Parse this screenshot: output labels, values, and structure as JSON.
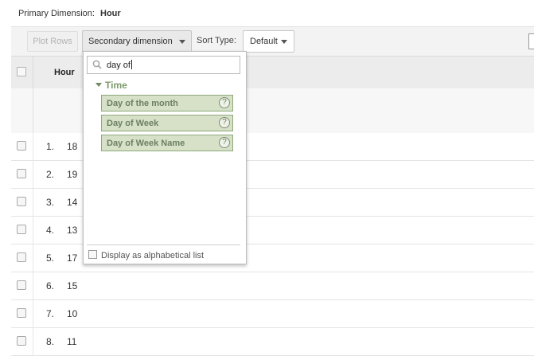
{
  "primary_dimension": {
    "label": "Primary Dimension:",
    "value": "Hour"
  },
  "toolbar": {
    "plot_rows_label": "Plot Rows",
    "secondary_dimension_label": "Secondary dimension",
    "sort_type_label": "Sort Type:",
    "sort_type_value": "Default"
  },
  "table": {
    "header": {
      "hour_label": "Hour"
    },
    "rows": [
      {
        "index": "1.",
        "value": "18"
      },
      {
        "index": "2.",
        "value": "19"
      },
      {
        "index": "3.",
        "value": "14"
      },
      {
        "index": "4.",
        "value": "13"
      },
      {
        "index": "5.",
        "value": "17"
      },
      {
        "index": "6.",
        "value": "15"
      },
      {
        "index": "7.",
        "value": "10"
      },
      {
        "index": "8.",
        "value": "11"
      }
    ]
  },
  "dropdown": {
    "search_value": "day of",
    "group": "Time",
    "options": [
      {
        "label": "Day of the month"
      },
      {
        "label": "Day of Week"
      },
      {
        "label": "Day of Week Name"
      }
    ],
    "help_glyph": "?",
    "alphabetical_label": "Display as alphabetical list"
  },
  "colors": {
    "option_bg": "#d6e1c7",
    "option_border": "#8fa87c",
    "group_text": "#7c9a6b"
  }
}
